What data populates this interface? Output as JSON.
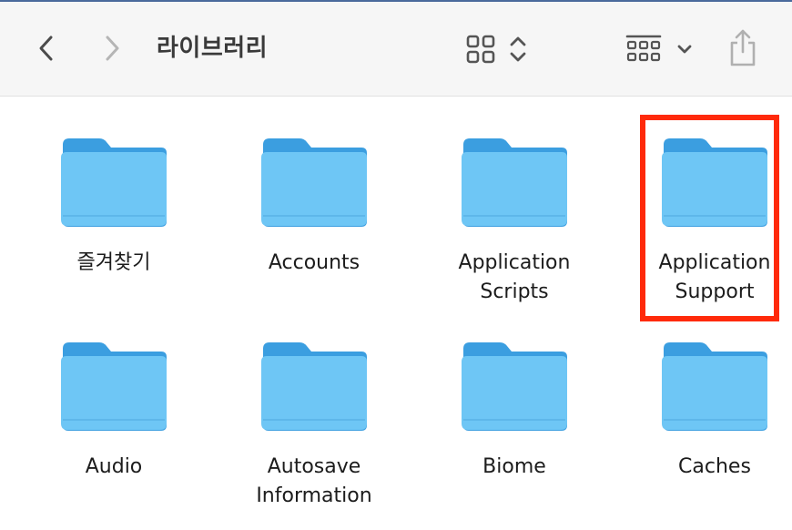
{
  "window": {
    "title": "라이브러리"
  },
  "toolbar": {
    "back_icon": "chevron-left-icon",
    "forward_icon": "chevron-right-icon",
    "view_icon": "icon-grid-view-icon",
    "view_chevron_icon": "up-down-chevron-icon",
    "group_icon": "group-by-icon",
    "group_chevron_icon": "chevron-down-icon",
    "share_icon": "share-icon"
  },
  "folders": [
    {
      "label": "즐겨찾기"
    },
    {
      "label": "Accounts"
    },
    {
      "label": "Application\nScripts"
    },
    {
      "label": "Application\nSupport"
    },
    {
      "label": "Audio"
    },
    {
      "label": "Autosave\nInformation"
    },
    {
      "label": "Biome"
    },
    {
      "label": "Caches"
    }
  ],
  "colors": {
    "folder_front": "#6ec6f5",
    "folder_back": "#3b9ee0",
    "highlight": "#ff2a0a",
    "toolbar_bg": "#f6f6f6"
  }
}
